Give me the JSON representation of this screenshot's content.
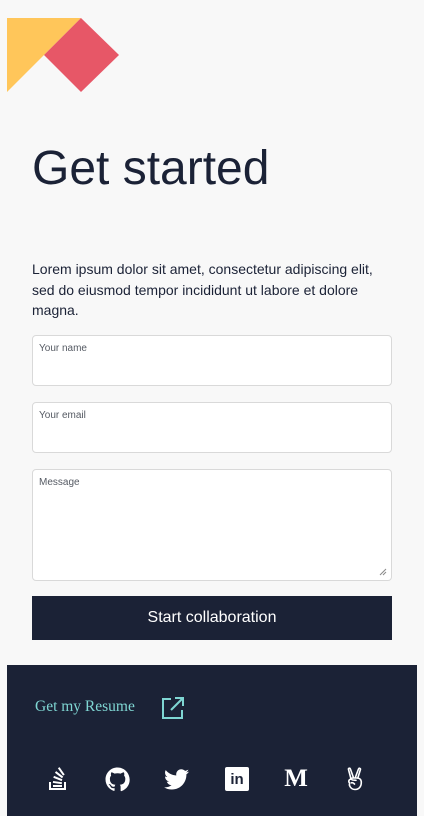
{
  "hero": {
    "title": "Get started",
    "intro": "Lorem ipsum dolor sit amet, consectetur adipiscing elit, sed do eiusmod tempor incididunt ut labore et dolore magna."
  },
  "form": {
    "name_label": "Your name",
    "email_label": "Your email",
    "message_label": "Message",
    "submit_label": "Start collaboration"
  },
  "footer": {
    "resume_link": "Get my Resume",
    "social": [
      {
        "icon": "stackoverflow-icon"
      },
      {
        "icon": "github-icon"
      },
      {
        "icon": "twitter-icon"
      },
      {
        "icon": "linkedin-icon",
        "text": "in"
      },
      {
        "icon": "medium-icon",
        "text": "M"
      },
      {
        "icon": "angellist-icon"
      }
    ]
  },
  "colors": {
    "navy": "#1b2236",
    "yellow": "#ffc65a",
    "coral": "#e75767",
    "teal": "#7fd6d3",
    "background": "#f8f8f8"
  }
}
